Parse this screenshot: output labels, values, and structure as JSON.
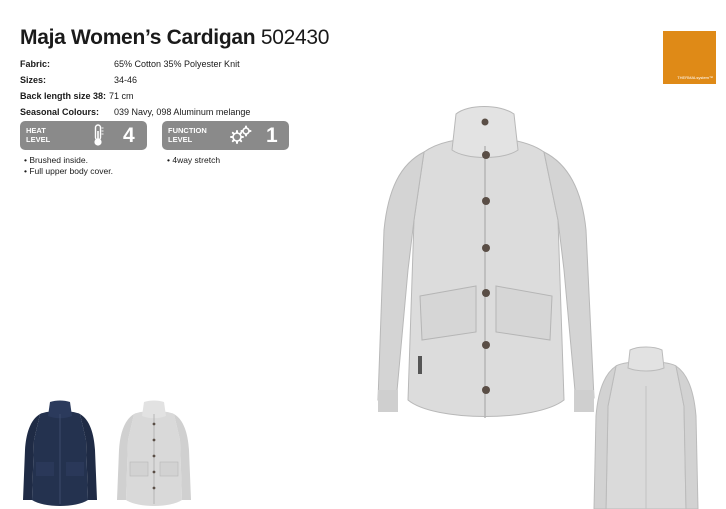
{
  "product": {
    "name": "Maja Women’s Cardigan",
    "code": "502430"
  },
  "specs": [
    {
      "label": "Fabric:",
      "value": "65% Cotton 35% Polyester Knit"
    },
    {
      "label": "Sizes:",
      "value": "34-46"
    },
    {
      "label": "Back length size 38:",
      "value": "71 cm"
    },
    {
      "label": "Seasonal Colours:",
      "value": "039 Navy, 098 Aluminum melange"
    }
  ],
  "heat_level": {
    "label_line1": "HEAT",
    "label_line2": "LEVEL",
    "value": "4",
    "icon": "thermometer-icon",
    "bullets": [
      "Brushed inside.",
      "Full upper body cover."
    ]
  },
  "function_level": {
    "label_line1": "FUNCTION",
    "label_line2": "LEVEL",
    "value": "1",
    "icon": "gears-icon",
    "bullets": [
      "4way stretch"
    ]
  },
  "badge": {
    "text": "THERMALsystem™",
    "color": "#df8a17"
  },
  "colors": {
    "navy": "#24324f",
    "aluminum_melange": "#d9d9d9",
    "level_box": "#8a8a8a"
  }
}
